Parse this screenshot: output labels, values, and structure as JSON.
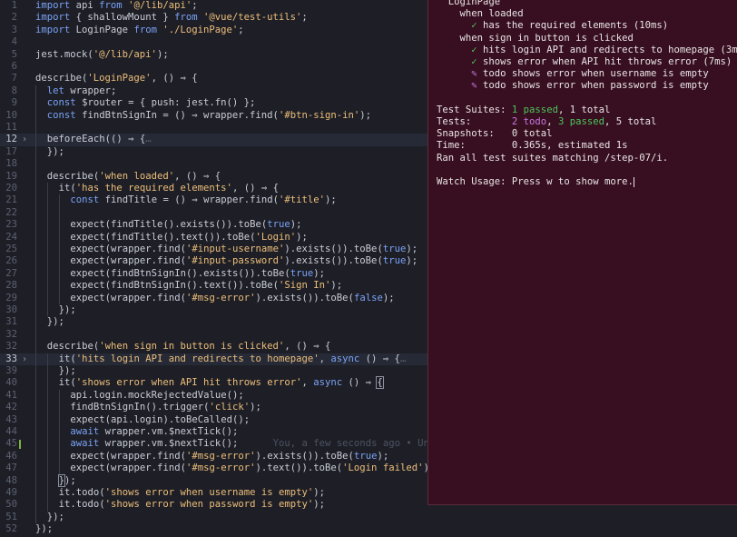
{
  "editor": {
    "blame_text": "You, a few seconds ago • Unco",
    "lines": [
      {
        "n": "1",
        "indent": 0,
        "t": [
          [
            "k",
            "import "
          ],
          [
            "f",
            "api "
          ],
          [
            "k",
            "from "
          ],
          [
            "s",
            "'@/lib/api'"
          ],
          [
            "f",
            ";"
          ]
        ]
      },
      {
        "n": "2",
        "indent": 0,
        "t": [
          [
            "k",
            "import "
          ],
          [
            "f",
            "{ shallowMount } "
          ],
          [
            "k",
            "from "
          ],
          [
            "s",
            "'@vue/test-utils'"
          ],
          [
            "f",
            ";"
          ]
        ]
      },
      {
        "n": "3",
        "indent": 0,
        "t": [
          [
            "k",
            "import "
          ],
          [
            "f",
            "LoginPage "
          ],
          [
            "k",
            "from "
          ],
          [
            "s",
            "'./LoginPage'"
          ],
          [
            "f",
            ";"
          ]
        ]
      },
      {
        "n": "4",
        "indent": 0,
        "t": []
      },
      {
        "n": "5",
        "indent": 0,
        "t": [
          [
            "f",
            "jest.mock("
          ],
          [
            "s",
            "'@/lib/api'"
          ],
          [
            "f",
            ");"
          ]
        ]
      },
      {
        "n": "6",
        "indent": 0,
        "t": []
      },
      {
        "n": "7",
        "indent": 0,
        "t": [
          [
            "f",
            "describe("
          ],
          [
            "s",
            "'LoginPage'"
          ],
          [
            "f",
            ", () ⇒ {"
          ]
        ]
      },
      {
        "n": "8",
        "indent": 1,
        "t": [
          [
            "k",
            "let "
          ],
          [
            "f",
            "wrapper;"
          ]
        ]
      },
      {
        "n": "9",
        "indent": 1,
        "t": [
          [
            "k",
            "const "
          ],
          [
            "f",
            "$router = { push: jest.fn() };"
          ]
        ]
      },
      {
        "n": "10",
        "indent": 1,
        "t": [
          [
            "k",
            "const "
          ],
          [
            "f",
            "findBtnSignIn = () ⇒ wrapper.find("
          ],
          [
            "s",
            "'#btn-sign-in'"
          ],
          [
            "f",
            ");"
          ]
        ]
      },
      {
        "n": "11",
        "indent": 1,
        "t": []
      },
      {
        "n": "12",
        "indent": 1,
        "hl": true,
        "fold": true,
        "t": [
          [
            "f",
            "beforeEach(() ⇒ {"
          ],
          [
            "c",
            "…"
          ]
        ]
      },
      {
        "n": "17",
        "indent": 1,
        "t": [
          [
            "f",
            "});"
          ]
        ]
      },
      {
        "n": "18",
        "indent": 1,
        "t": []
      },
      {
        "n": "19",
        "indent": 1,
        "t": [
          [
            "f",
            "describe("
          ],
          [
            "s",
            "'when loaded'"
          ],
          [
            "f",
            ", () ⇒ {"
          ]
        ]
      },
      {
        "n": "20",
        "indent": 2,
        "t": [
          [
            "f",
            "it("
          ],
          [
            "s",
            "'has the required elements'"
          ],
          [
            "f",
            ", () ⇒ {"
          ]
        ]
      },
      {
        "n": "21",
        "indent": 3,
        "t": [
          [
            "k",
            "const "
          ],
          [
            "f",
            "findTitle = () ⇒ wrapper.find("
          ],
          [
            "s",
            "'#title'"
          ],
          [
            "f",
            ");"
          ]
        ]
      },
      {
        "n": "22",
        "indent": 3,
        "t": []
      },
      {
        "n": "23",
        "indent": 3,
        "t": [
          [
            "f",
            "expect(findTitle().exists()).toBe("
          ],
          [
            "k",
            "true"
          ],
          [
            "f",
            ");"
          ]
        ]
      },
      {
        "n": "24",
        "indent": 3,
        "t": [
          [
            "f",
            "expect(findTitle().text()).toBe("
          ],
          [
            "s",
            "'Login'"
          ],
          [
            "f",
            ");"
          ]
        ]
      },
      {
        "n": "25",
        "indent": 3,
        "t": [
          [
            "f",
            "expect(wrapper.find("
          ],
          [
            "s",
            "'#input-username'"
          ],
          [
            "f",
            ").exists()).toBe("
          ],
          [
            "k",
            "true"
          ],
          [
            "f",
            ");"
          ]
        ]
      },
      {
        "n": "26",
        "indent": 3,
        "t": [
          [
            "f",
            "expect(wrapper.find("
          ],
          [
            "s",
            "'#input-password'"
          ],
          [
            "f",
            ").exists()).toBe("
          ],
          [
            "k",
            "true"
          ],
          [
            "f",
            ");"
          ]
        ]
      },
      {
        "n": "27",
        "indent": 3,
        "t": [
          [
            "f",
            "expect(findBtnSignIn().exists()).toBe("
          ],
          [
            "k",
            "true"
          ],
          [
            "f",
            ");"
          ]
        ]
      },
      {
        "n": "28",
        "indent": 3,
        "t": [
          [
            "f",
            "expect(findBtnSignIn().text()).toBe("
          ],
          [
            "s",
            "'Sign In'"
          ],
          [
            "f",
            ");"
          ]
        ]
      },
      {
        "n": "29",
        "indent": 3,
        "t": [
          [
            "f",
            "expect(wrapper.find("
          ],
          [
            "s",
            "'#msg-error'"
          ],
          [
            "f",
            ").exists()).toBe("
          ],
          [
            "k",
            "false"
          ],
          [
            "f",
            ");"
          ]
        ]
      },
      {
        "n": "30",
        "indent": 2,
        "t": [
          [
            "f",
            "});"
          ]
        ]
      },
      {
        "n": "31",
        "indent": 1,
        "t": [
          [
            "f",
            "});"
          ]
        ]
      },
      {
        "n": "32",
        "indent": 1,
        "t": []
      },
      {
        "n": "32",
        "indent": 1,
        "t": [
          [
            "f",
            "describe("
          ],
          [
            "s",
            "'when sign in button is clicked'"
          ],
          [
            "f",
            ", () ⇒ {"
          ]
        ]
      },
      {
        "n": "33",
        "indent": 2,
        "hl": true,
        "fold": true,
        "t": [
          [
            "f",
            "it("
          ],
          [
            "s",
            "'hits login API and redirects to homepage'"
          ],
          [
            "f",
            ", "
          ],
          [
            "k",
            "async "
          ],
          [
            "f",
            "() ⇒ {"
          ],
          [
            "c",
            "…"
          ]
        ]
      },
      {
        "n": "39",
        "indent": 2,
        "t": [
          [
            "f",
            "});"
          ]
        ]
      },
      {
        "n": "40",
        "indent": 2,
        "t": [
          [
            "f",
            "it("
          ],
          [
            "s",
            "'shows error when API hit throws error'"
          ],
          [
            "f",
            ", "
          ],
          [
            "k",
            "async "
          ],
          [
            "f",
            "() ⇒ "
          ],
          [
            "bracket",
            "{"
          ]
        ]
      },
      {
        "n": "41",
        "indent": 3,
        "t": [
          [
            "f",
            "api.login.mockRejectedValue();"
          ]
        ]
      },
      {
        "n": "42",
        "indent": 3,
        "t": [
          [
            "f",
            "findBtnSignIn().trigger("
          ],
          [
            "s",
            "'click'"
          ],
          [
            "f",
            ");"
          ]
        ]
      },
      {
        "n": "43",
        "indent": 3,
        "t": [
          [
            "f",
            "expect(api.login).toBeCalled();"
          ]
        ]
      },
      {
        "n": "44",
        "indent": 3,
        "t": [
          [
            "k",
            "await "
          ],
          [
            "f",
            "wrapper.vm.$nextTick();"
          ]
        ]
      },
      {
        "n": "45",
        "indent": 3,
        "mod": true,
        "blame": true,
        "t": [
          [
            "k",
            "await "
          ],
          [
            "f",
            "wrapper.vm.$nextTick();"
          ]
        ]
      },
      {
        "n": "46",
        "indent": 3,
        "t": [
          [
            "f",
            "expect(wrapper.find("
          ],
          [
            "s",
            "'#msg-error'"
          ],
          [
            "f",
            ").exists()).toBe("
          ],
          [
            "k",
            "true"
          ],
          [
            "f",
            ");"
          ]
        ]
      },
      {
        "n": "47",
        "indent": 3,
        "t": [
          [
            "f",
            "expect(wrapper.find("
          ],
          [
            "s",
            "'#msg-error'"
          ],
          [
            "f",
            ").text()).toBe("
          ],
          [
            "s",
            "'Login failed'"
          ],
          [
            "f",
            ");"
          ]
        ]
      },
      {
        "n": "48",
        "indent": 2,
        "t": [
          [
            "bracket",
            "}"
          ],
          [
            "f",
            ");"
          ]
        ]
      },
      {
        "n": "49",
        "indent": 2,
        "t": [
          [
            "f",
            "it.todo("
          ],
          [
            "s",
            "'shows error when username is empty'"
          ],
          [
            "f",
            ");"
          ]
        ]
      },
      {
        "n": "50",
        "indent": 2,
        "t": [
          [
            "f",
            "it.todo("
          ],
          [
            "s",
            "'shows error when password is empty'"
          ],
          [
            "f",
            ");"
          ]
        ]
      },
      {
        "n": "51",
        "indent": 1,
        "t": [
          [
            "f",
            "});"
          ]
        ]
      },
      {
        "n": "52",
        "indent": 0,
        "t": [
          [
            "f",
            "});"
          ]
        ]
      }
    ]
  },
  "terminal": {
    "lines": [
      [
        [
          "",
          "  LoginPage"
        ]
      ],
      [
        [
          "",
          "    when loaded"
        ]
      ],
      [
        [
          "ok",
          "      ✓ "
        ],
        [
          "",
          "has the required elements (10ms)"
        ]
      ],
      [
        [
          "",
          "    when sign in button is clicked"
        ]
      ],
      [
        [
          "ok",
          "      ✓ "
        ],
        [
          "",
          "hits login API and redirects to homepage (3ms)"
        ]
      ],
      [
        [
          "ok",
          "      ✓ "
        ],
        [
          "",
          "shows error when API hit throws error (7ms)"
        ]
      ],
      [
        [
          "todo",
          "      ✎ "
        ],
        [
          "",
          "todo shows error when username is empty"
        ]
      ],
      [
        [
          "todo",
          "      ✎ "
        ],
        [
          "",
          "todo shows error when password is empty"
        ]
      ],
      [
        [
          "",
          ""
        ]
      ],
      [
        [
          "",
          "Test Suites: "
        ],
        [
          "ok",
          "1 passed"
        ],
        [
          "",
          ", 1 total"
        ]
      ],
      [
        [
          "",
          "Tests:       "
        ],
        [
          "todo",
          "2 todo"
        ],
        [
          "",
          ", "
        ],
        [
          "ok",
          "3 passed"
        ],
        [
          "",
          ", 5 total"
        ]
      ],
      [
        [
          "",
          "Snapshots:   0 total"
        ]
      ],
      [
        [
          "",
          "Time:        0.365s, estimated 1s"
        ]
      ],
      [
        [
          "",
          "Ran all test suites matching /step-07/i."
        ]
      ],
      [
        [
          "",
          ""
        ]
      ],
      [
        [
          "",
          "Watch Usage: Press w to show more."
        ],
        [
          "cursor",
          ""
        ]
      ]
    ]
  },
  "colors": {
    "editor_bg": "#1e1f26",
    "terminal_bg": "#380f20",
    "keyword": "#7aa2f7",
    "string": "#ecbe7b",
    "pass": "#4cc35b",
    "todo": "#c678dd",
    "modified_gutter": "#7cb342"
  }
}
